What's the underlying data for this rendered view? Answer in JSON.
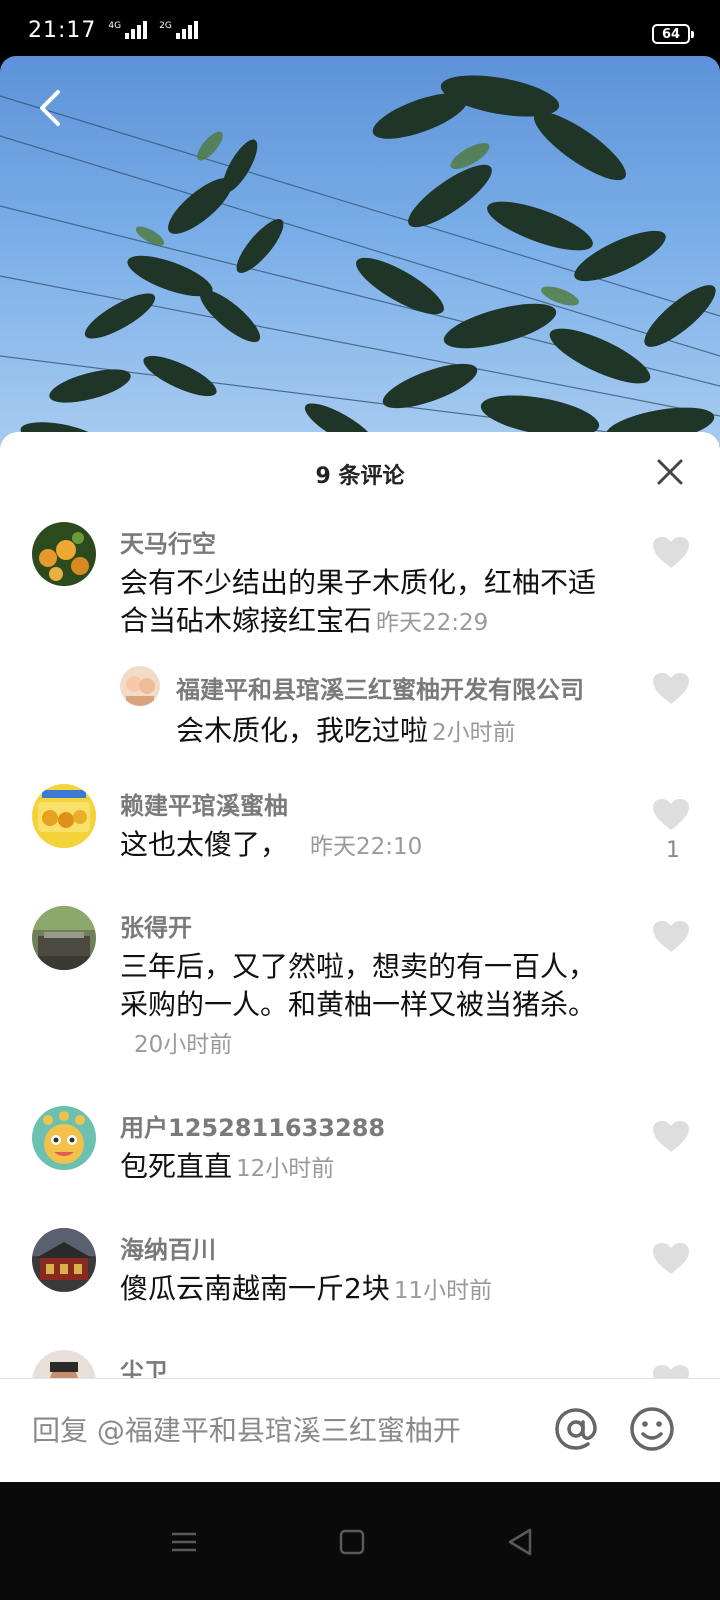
{
  "status_bar": {
    "time": "21:17",
    "signal1": "4G",
    "signal2": "2G",
    "battery": "64"
  },
  "sheet": {
    "title": "9 条评论"
  },
  "comments": [
    {
      "user": "天马行空",
      "text": "会有不少结出的果子木质化，红柚不适合当砧木嫁接红宝石",
      "time": "昨天22:29",
      "likes": ""
    },
    {
      "user": "福建平和县琯溪三红蜜柚开发有限公司",
      "text": "会木质化，我吃过啦",
      "time": "2小时前",
      "likes": ""
    },
    {
      "user": "赖建平琯溪蜜柚",
      "text": "这也太傻了，",
      "time": "昨天22:10",
      "likes": "1"
    },
    {
      "user": "张得开",
      "text": "三年后，又了然啦，想卖的有一百人，采购的一人。和黄柚一样又被当猪杀。",
      "time": "20小时前",
      "likes": ""
    },
    {
      "user": "用户1252811633288",
      "text": "包死直直",
      "time": "12小时前",
      "likes": ""
    },
    {
      "user": "海纳百川",
      "text": "傻瓜云南越南一斤2块",
      "time": "11小时前",
      "likes": ""
    },
    {
      "user": "尘卫",
      "text": "",
      "time": "",
      "likes": ""
    }
  ],
  "input": {
    "placeholder": "回复 @福建平和县琯溪三红蜜柚开"
  },
  "icons": {
    "back": "chevron-left-icon",
    "close": "close-icon",
    "like": "heart-icon",
    "at": "at-icon",
    "emoji": "smiley-icon",
    "nav": [
      "menu-icon",
      "home-square-icon",
      "back-triangle-icon"
    ]
  }
}
